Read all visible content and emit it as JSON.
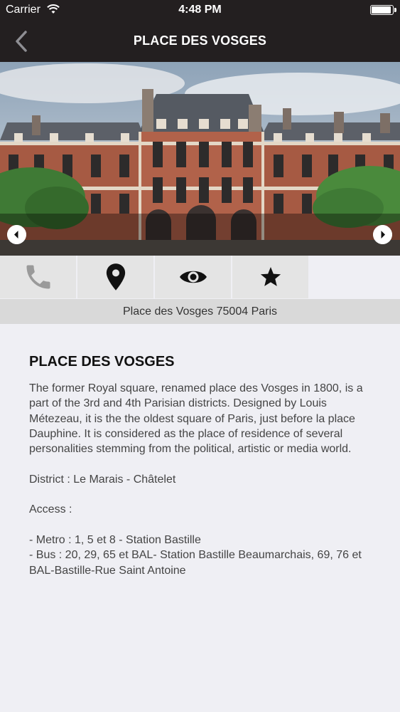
{
  "status_bar": {
    "carrier": "Carrier",
    "time": "4:48 PM"
  },
  "nav": {
    "title": "PLACE DES VOSGES"
  },
  "address": "Place des Vosges 75004 Paris",
  "actions": [
    {
      "icon": "phone-icon",
      "enabled": false
    },
    {
      "icon": "map-pin-icon",
      "enabled": true
    },
    {
      "icon": "eye-icon",
      "enabled": true
    },
    {
      "icon": "star-icon",
      "enabled": true
    }
  ],
  "content": {
    "title": "PLACE DES VOSGES",
    "description": "The former Royal square, renamed place des Vosges in 1800, is a part of the 3rd and 4th Parisian districts. Designed by Louis Métezeau, it is the the oldest square of Paris, just before la place Dauphine. It is considered as the place of residence of several personalities stemming from the political, artistic or media world.\n\nDistrict : Le Marais - Châtelet\n\nAccess :\n\n- Metro : 1, 5 et 8 - Station Bastille\n- Bus : 20, 29, 65 et BAL- Station Bastille Beaumarchais, 69, 76 et BAL-Bastille-Rue Saint Antoine"
  },
  "colors": {
    "bar": "#231f20",
    "background": "#efeff4",
    "action_bg": "#e4e4e4",
    "address_bg": "#d9d9d9",
    "disabled_icon": "#9a9a9a"
  }
}
